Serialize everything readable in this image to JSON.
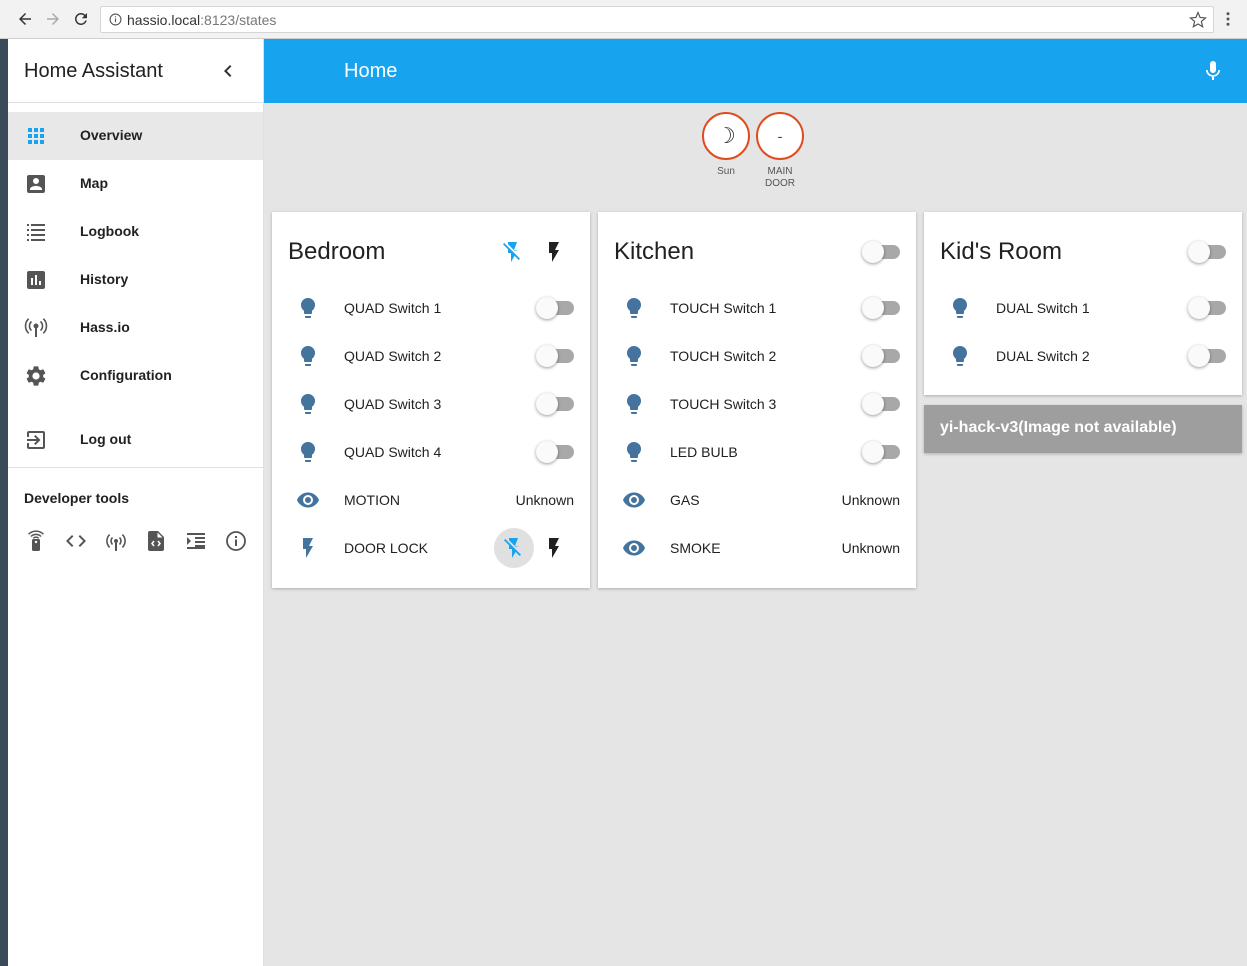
{
  "browser": {
    "url_host": "hassio.local",
    "url_path": ":8123/states"
  },
  "sidebar": {
    "title": "Home Assistant",
    "items": [
      {
        "label": "Overview",
        "icon": "apps-icon"
      },
      {
        "label": "Map",
        "icon": "account-box-icon"
      },
      {
        "label": "Logbook",
        "icon": "format-list-icon"
      },
      {
        "label": "History",
        "icon": "poll-box-icon"
      },
      {
        "label": "Hass.io",
        "icon": "hassio-icon"
      },
      {
        "label": "Configuration",
        "icon": "settings-icon"
      },
      {
        "label": "Log out",
        "icon": "exit-to-app-icon"
      }
    ],
    "developer_tools_title": "Developer tools"
  },
  "toolbar": {
    "title": "Home",
    "accent": "#18a3ef"
  },
  "badges": [
    {
      "value": "☽",
      "label": "Sun"
    },
    {
      "value": "-",
      "label": "MAIN DOOR"
    }
  ],
  "cards": {
    "bedroom": {
      "title": "Bedroom",
      "rows": [
        {
          "name": "QUAD Switch 1",
          "icon": "lightbulb-icon"
        },
        {
          "name": "QUAD Switch 2",
          "icon": "lightbulb-icon"
        },
        {
          "name": "QUAD Switch 3",
          "icon": "lightbulb-icon"
        },
        {
          "name": "QUAD Switch 4",
          "icon": "lightbulb-icon"
        },
        {
          "name": "MOTION",
          "icon": "eye-icon",
          "state": "Unknown"
        },
        {
          "name": "DOOR LOCK",
          "icon": "flash-icon"
        }
      ]
    },
    "kitchen": {
      "title": "Kitchen",
      "rows": [
        {
          "name": "TOUCH Switch 1",
          "icon": "lightbulb-icon"
        },
        {
          "name": "TOUCH Switch 2",
          "icon": "lightbulb-icon"
        },
        {
          "name": "TOUCH Switch 3",
          "icon": "lightbulb-icon"
        },
        {
          "name": "LED BULB",
          "icon": "lightbulb-icon"
        },
        {
          "name": "GAS",
          "icon": "eye-icon",
          "state": "Unknown"
        },
        {
          "name": "SMOKE",
          "icon": "eye-icon",
          "state": "Unknown"
        }
      ]
    },
    "kids_room": {
      "title": "Kid's Room",
      "rows": [
        {
          "name": "DUAL Switch 1",
          "icon": "lightbulb-icon"
        },
        {
          "name": "DUAL Switch 2",
          "icon": "lightbulb-icon"
        }
      ]
    }
  },
  "camera": {
    "text": "yi-hack-v3(Image not available)"
  },
  "colors": {
    "icon_blue": "#44739e",
    "badge_border": "#df4c1e"
  }
}
